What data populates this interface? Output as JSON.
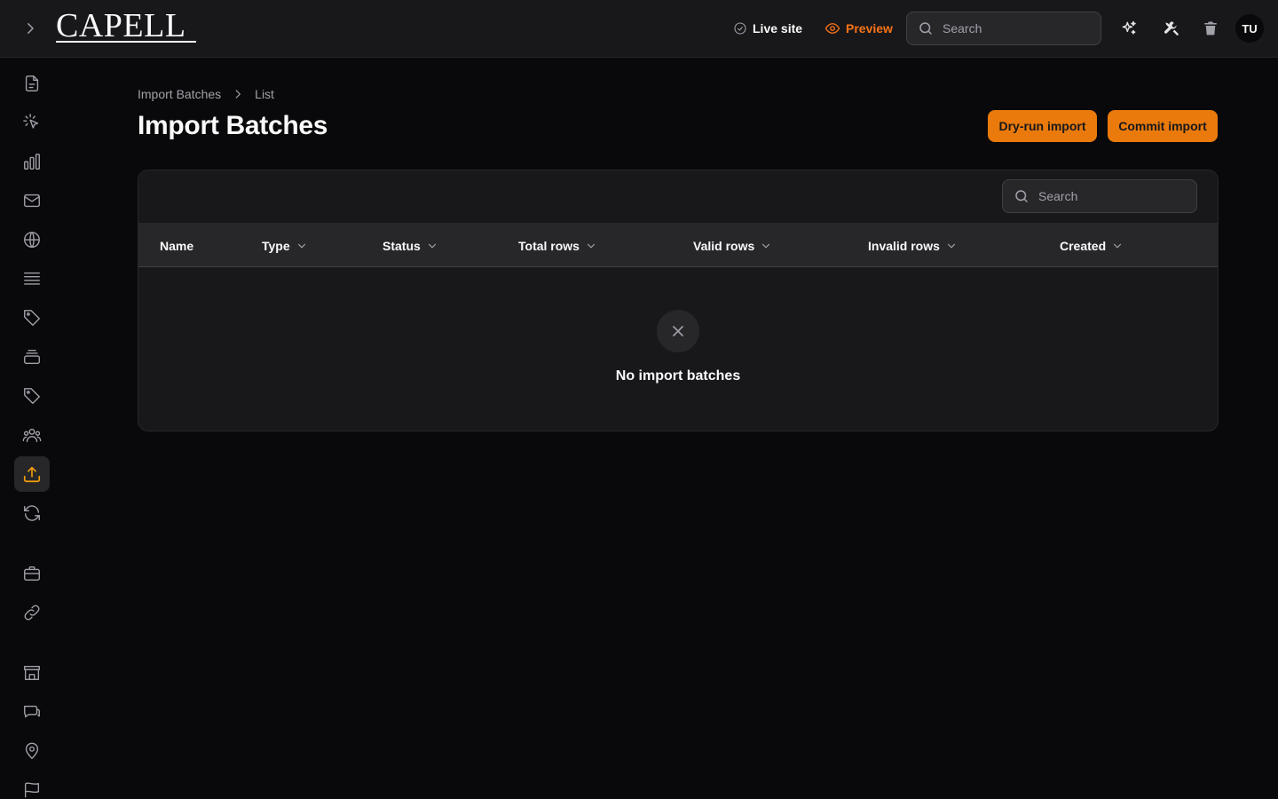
{
  "header": {
    "logo": "CAPELL",
    "live_site_label": "Live site",
    "preview_label": "Preview",
    "search_placeholder": "Search",
    "avatar_initials": "TU"
  },
  "breadcrumb": {
    "items": [
      "Import Batches",
      "List"
    ]
  },
  "page": {
    "title": "Import Batches",
    "dry_run_label": "Dry-run import",
    "commit_label": "Commit import"
  },
  "table": {
    "search_placeholder": "Search",
    "columns": [
      "Name",
      "Type",
      "Status",
      "Total rows",
      "Valid rows",
      "Invalid rows",
      "Created"
    ],
    "empty_message": "No import batches"
  },
  "colors": {
    "accent": "#ea7a0c",
    "background": "#09090b",
    "surface": "#18181b"
  },
  "sidebar": {
    "icons": [
      "document-icon",
      "cursor-click-icon",
      "bar-chart-icon",
      "mail-icon",
      "globe-icon",
      "list-icon",
      "tag-icon",
      "stack-icon",
      "tag-icon",
      "users-group-icon",
      "upload-icon",
      "refresh-icon",
      "briefcase-icon",
      "link-icon",
      "store-icon",
      "chat-icon",
      "map-pin-icon",
      "flag-icon"
    ],
    "active": "upload-icon"
  }
}
